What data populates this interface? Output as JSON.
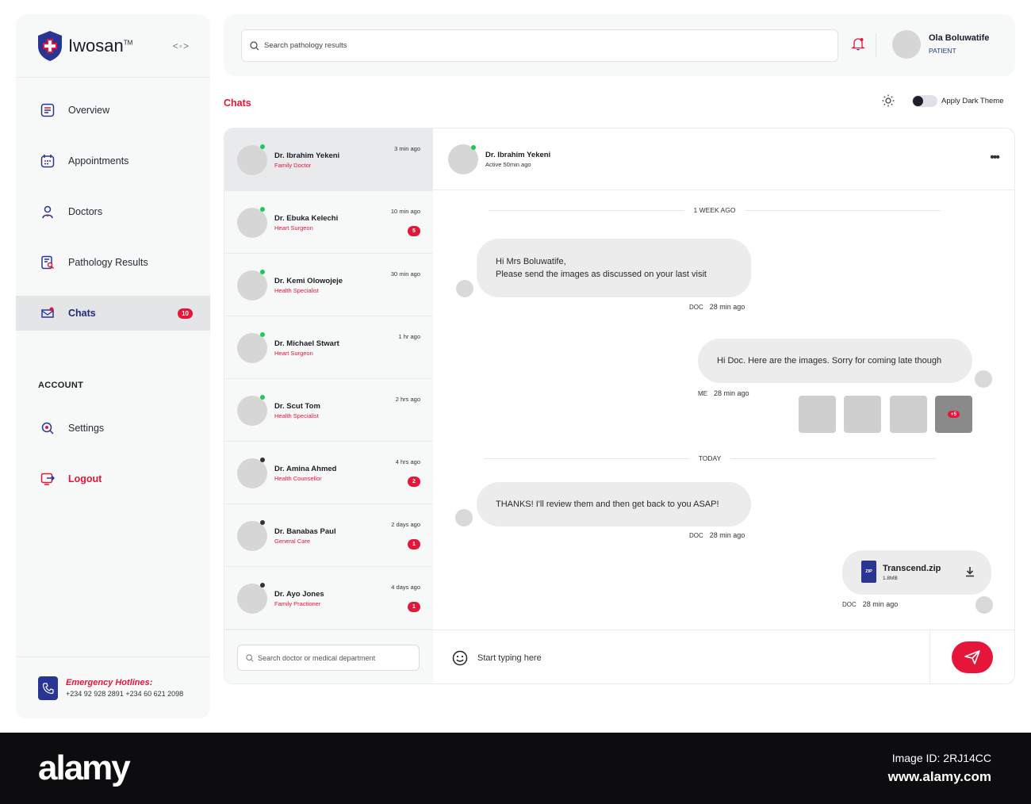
{
  "app": {
    "name": "Iwosan",
    "trademark": "TM",
    "collapse_toggle": "<◦>"
  },
  "sidebar": {
    "items": [
      {
        "label": "Overview",
        "icon": "overview-icon"
      },
      {
        "label": "Appointments",
        "icon": "calendar-icon"
      },
      {
        "label": "Doctors",
        "icon": "doctor-icon"
      },
      {
        "label": "Pathology Results",
        "icon": "pathology-icon"
      },
      {
        "label": "Chats",
        "icon": "chat-icon",
        "count": "10",
        "active": true
      }
    ],
    "section_label": "ACCOUNT",
    "account_items": [
      {
        "label": "Settings",
        "icon": "settings-icon"
      },
      {
        "label": "Logout",
        "icon": "logout-icon"
      }
    ],
    "hotline": {
      "title": "Emergency Hotlines:",
      "numbers": "+234 92 928 2891  +234 60 621 2098"
    }
  },
  "topbar": {
    "search_placeholder": "Search pathology results",
    "user_name": "Ola Boluwatife",
    "user_role": "PATIENT"
  },
  "page_title": "Chats",
  "theme": {
    "label": "Apply Dark Theme",
    "enabled": false
  },
  "contacts": [
    {
      "name": "Dr. Ibrahim Yekeni",
      "specialty": "Family Doctor",
      "time": "3 min ago",
      "online": true,
      "selected": true
    },
    {
      "name": "Dr. Ebuka Kelechi",
      "specialty": "Heart Surgeon",
      "time": "10 min ago",
      "online": true,
      "badge": "5"
    },
    {
      "name": "Dr. Kemi Olowojeje",
      "specialty": "Health Specialist",
      "time": "30 min ago",
      "online": true
    },
    {
      "name": "Dr. Michael Stwart",
      "specialty": "Heart Surgeon",
      "time": "1 hr ago",
      "online": true
    },
    {
      "name": "Dr. Scut Tom",
      "specialty": "Health Specialist",
      "time": "2 hrs ago",
      "online": true
    },
    {
      "name": "Dr. Amina Ahmed",
      "specialty": "Health Counsellor",
      "time": "4 hrs ago",
      "online": false,
      "badge": "2"
    },
    {
      "name": "Dr. Banabas Paul",
      "specialty": "General Care",
      "time": "2 days ago",
      "online": false,
      "badge": "1"
    },
    {
      "name": "Dr. Ayo Jones",
      "specialty": "Family Practioner",
      "time": "4 days ago",
      "online": false,
      "badge": "1"
    }
  ],
  "contact_search_placeholder": "Search doctor or medical department",
  "conversation": {
    "name": "Dr. Ibrahim Yekeni",
    "status": "Active 50min ago",
    "dividers": [
      "1 WEEK AGO",
      "TODAY"
    ],
    "messages": [
      {
        "from": "DOC",
        "line1": "Hi Mrs Boluwatife,",
        "line2": "Please send the images as discussed on your last visit",
        "time": "28 min ago"
      },
      {
        "from": "ME",
        "text": "Hi Doc. Here are the images. Sorry for coming late though",
        "time": "28 min ago",
        "more_images": "+5"
      },
      {
        "from": "DOC",
        "text": "THANKS! I'll review them and then get back to you ASAP!",
        "time": "28 min ago"
      },
      {
        "from": "DOC",
        "file_name": "Transcend.zip",
        "file_size": "1.8MB",
        "file_type": "ZIP",
        "time": "28 min ago"
      }
    ]
  },
  "composer": {
    "placeholder": "Start typing here"
  },
  "banner": {
    "logo": "alamy",
    "image_id": "Image ID: 2RJ14CC",
    "site": "www.alamy.com"
  },
  "colors": {
    "accent": "#e5163a",
    "brand_blue": "#283593",
    "panel": "#f7f8f8",
    "bubble": "#ececec"
  }
}
